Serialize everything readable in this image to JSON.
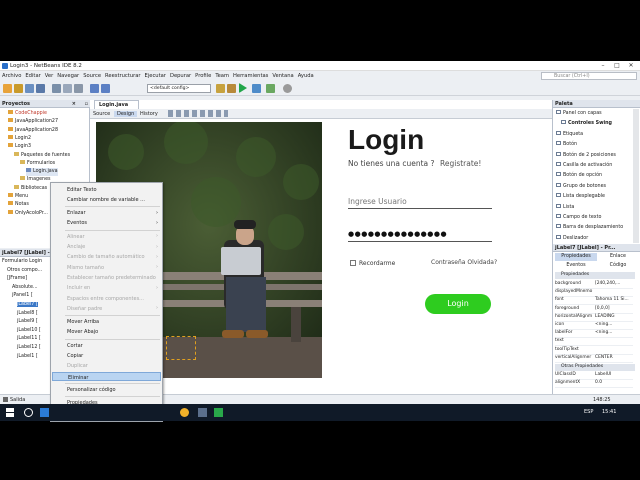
{
  "window": {
    "title": "Login3 - NetBeans IDE 8.2"
  },
  "menu": [
    "Archivo",
    "Editar",
    "Ver",
    "Navegar",
    "Source",
    "Reestructurar",
    "Ejecutar",
    "Depurar",
    "Profile",
    "Team",
    "Herramientas",
    "Ventana",
    "Ayuda"
  ],
  "search": {
    "placeholder": "Buscar (Ctrl+I)"
  },
  "toolbar": {
    "config_value": "<default config>"
  },
  "projects": {
    "title": "Proyectos",
    "items": [
      "CodeChappie",
      "JavaApplication27",
      "JavaApplication28",
      "Login2",
      "Login3",
      "Paquetes de fuentes",
      "Formularios",
      "Login.java",
      "Imagenes",
      "Bibliotecas",
      "Menu",
      "Notas",
      "OnlyAcoloPr..."
    ]
  },
  "navigator": {
    "title": "jLabel7 [JLabel] - N...",
    "items": [
      "Formulario Login",
      "Otros compo...",
      "[JFrame]",
      "Absolute...",
      "jPanel1 [",
      "jLabel7 [",
      "jLabel8 [",
      "jLabel9 [",
      "jLabel10 [",
      "jLabel11 [",
      "jLabel12 [",
      "jLabel1 ["
    ]
  },
  "editor": {
    "tab": "Login.java",
    "views": [
      "Source",
      "Design",
      "History"
    ]
  },
  "login_form": {
    "title": "Login",
    "no_account": "No tienes una cuenta ?",
    "register": "Registrate!",
    "user_placeholder": "Ingrese Usuario",
    "password_mask": "●●●●●●●●●●●●●●●",
    "remember": "Recordarme",
    "forgot": "Contraseña Olvidada?",
    "login_button": "Login"
  },
  "palette": {
    "title": "Paleta",
    "items": [
      "Panel con capas",
      "Controles Swing",
      "Etiqueta",
      "Botón",
      "Botón de 2 posiciones",
      "Casilla de activación",
      "Botón de opción",
      "Grupo de botones",
      "Lista desplegable",
      "Lista",
      "Campo de texto",
      "Barra de desplazamiento",
      "Deslizador"
    ]
  },
  "properties": {
    "title": "jLabel7 [JLabel] - Pr...",
    "tabs": [
      "Propiedades",
      "Enlace",
      "Eventos",
      "Código"
    ],
    "section1": "Propiedades",
    "rows": [
      {
        "name": "background",
        "value": "[240,240,..."
      },
      {
        "name": "displayedMnemo",
        "value": ""
      },
      {
        "name": "font",
        "value": "Tahoma 11 Si..."
      },
      {
        "name": "foreground",
        "value": "[0,0,0]"
      },
      {
        "name": "horizontalAlignm",
        "value": "LEADING"
      },
      {
        "name": "icon",
        "value": "<ning..."
      },
      {
        "name": "labelFor",
        "value": "<ning..."
      },
      {
        "name": "text",
        "value": ""
      },
      {
        "name": "toolTipText",
        "value": ""
      },
      {
        "name": "verticalAlignmer",
        "value": "CENTER"
      }
    ],
    "section2": "Otras Propiedades",
    "rows2": [
      {
        "name": "UIClassID",
        "value": "LabelUI"
      },
      {
        "name": "alignmentX",
        "value": "0.0"
      }
    ]
  },
  "context_menu": [
    {
      "label": "Editar Texto",
      "state": "normal"
    },
    {
      "label": "Cambiar nombre de variable ...",
      "state": "normal"
    },
    {
      "label": "Enlazar",
      "state": "normal",
      "sub": true
    },
    {
      "label": "Eventos",
      "state": "normal",
      "sub": true
    },
    {
      "label": "Alinear",
      "state": "disabled",
      "sub": true
    },
    {
      "label": "Anclaje",
      "state": "disabled",
      "sub": true
    },
    {
      "label": "Cambio de tamaño automático",
      "state": "disabled",
      "sub": true
    },
    {
      "label": "Mismo tamaño",
      "state": "disabled",
      "sub": true
    },
    {
      "label": "Establecer tamaño predeterminado",
      "state": "disabled"
    },
    {
      "label": "Incluir en",
      "state": "disabled",
      "sub": true
    },
    {
      "label": "Espacios entre componentes...",
      "state": "disabled"
    },
    {
      "label": "Diseñar padre",
      "state": "disabled",
      "sub": true
    },
    {
      "label": "Mover Arriba",
      "state": "normal"
    },
    {
      "label": "Mover Abajo",
      "state": "normal"
    },
    {
      "label": "Cortar",
      "state": "normal"
    },
    {
      "label": "Copiar",
      "state": "normal"
    },
    {
      "label": "Duplicar",
      "state": "disabled"
    },
    {
      "label": "Eliminar",
      "state": "selected"
    },
    {
      "label": "Personalizar código",
      "state": "normal"
    },
    {
      "label": "Propiedades",
      "state": "normal"
    }
  ],
  "status": {
    "output": "Salida",
    "position": "148:25"
  },
  "taskbar": {
    "lang": "ESP",
    "time": "15:41"
  },
  "colors": {
    "accent_green": "#2ecc1f",
    "menu_highlight": "#b9d4f1",
    "ide_bg": "#eceff3"
  }
}
